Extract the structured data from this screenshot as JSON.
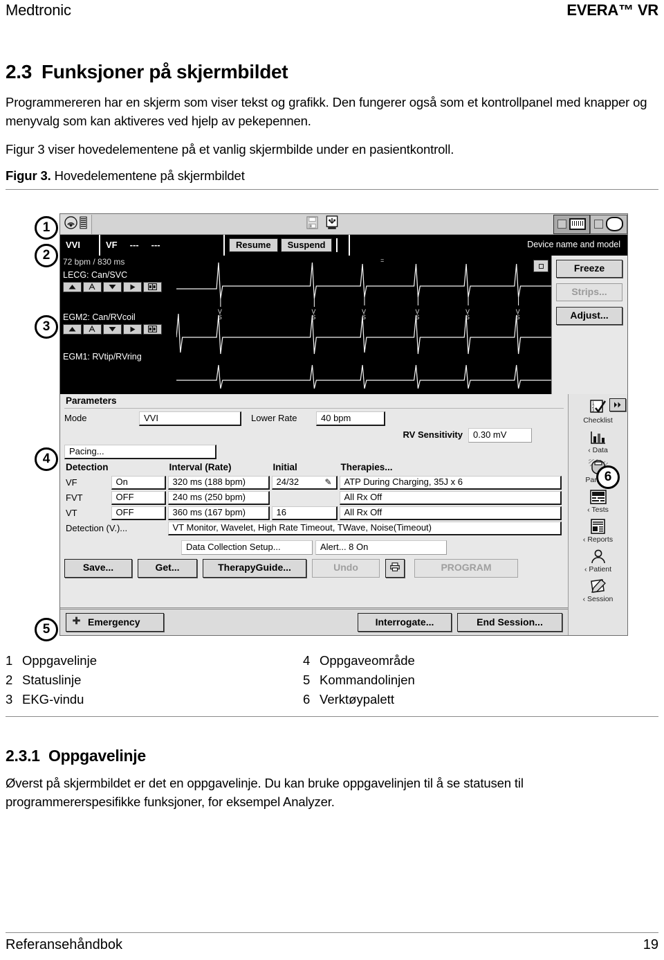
{
  "header": {
    "left": "Medtronic",
    "right": "EVERA™ VR"
  },
  "section": {
    "number": "2.3",
    "title": "Funksjoner på skjermbildet",
    "para1": "Programmereren har en skjerm som viser tekst og grafikk. Den fungerer også som et kontrollpanel med knapper og menyvalg som kan aktiveres ved hjelp av pekepennen.",
    "para2": "Figur 3 viser hovedelementene på et vanlig skjermbilde under en pasientkontroll.",
    "figure_caption_bold": "Figur 3.",
    "figure_caption_rest": "Hovedelementene på skjermbildet"
  },
  "figure": {
    "callouts": [
      "1",
      "2",
      "3",
      "4",
      "5",
      "6"
    ],
    "taskbar": {
      "icons": [
        "telemetry-icon",
        "battery-icon",
        "floppy-disk-icon",
        "usb-icon"
      ],
      "right_tabs": [
        "programmer-tab",
        "device-tab"
      ]
    },
    "statusline": {
      "mode": "VVI",
      "detection": "VF",
      "value1": "---",
      "value2": "---",
      "resume": "Resume",
      "suspend": "Suspend",
      "device_name": "Device name and model"
    },
    "ecg": {
      "rate": "72 bpm / 830 ms",
      "channel1": "LECG: Can/SVC",
      "channel2": "EGM2: Can/RVcoil",
      "channel3": "EGM1: RVtip/RVring",
      "marker": "VS",
      "buttons": [
        "Freeze",
        "Strips...",
        "Adjust..."
      ],
      "channel_controls": [
        "up-arrow-icon",
        "auto-gain-icon",
        "down-arrow-icon",
        "play-arrow-icon",
        "calipers-icon"
      ]
    },
    "parameters": {
      "heading": "Parameters",
      "mode_label": "Mode",
      "mode_value": "VVI",
      "lower_rate_label": "Lower Rate",
      "lower_rate_value": "40 bpm",
      "rv_sensitivity_label": "RV Sensitivity",
      "rv_sensitivity_value": "0.30 mV",
      "pacing_button": "Pacing..."
    },
    "detection_table": {
      "headers": [
        "Detection",
        "Interval (Rate)",
        "Initial",
        "Therapies..."
      ],
      "rows": [
        {
          "name": "VF",
          "on": "On",
          "interval": "320 ms (188 bpm)",
          "initial": "24/32",
          "pen": true,
          "therapy": "ATP During Charging, 35J x 6"
        },
        {
          "name": "FVT",
          "on": "OFF",
          "interval": "240 ms (250 bpm)",
          "initial": "",
          "pen": false,
          "therapy": "All Rx Off"
        },
        {
          "name": "VT",
          "on": "OFF",
          "interval": "360 ms (167 bpm)",
          "initial": "16",
          "pen": false,
          "therapy": "All Rx Off"
        }
      ],
      "footer_label": "Detection (V.)...",
      "footer_value": "VT Monitor, Wavelet, High Rate Timeout, TWave, Noise(Timeout)"
    },
    "task_buttons": {
      "data_collection": "Data Collection Setup...",
      "alert": "Alert... 8 On",
      "save": "Save...",
      "get": "Get...",
      "therapy_guide": "TherapyGuide...",
      "undo": "Undo",
      "print": "print-icon",
      "program": "PROGRAM"
    },
    "commandline": {
      "emergency": "Emergency",
      "emergency_icon": "emergency-cross-icon",
      "interrogate": "Interrogate...",
      "end_session": "End Session..."
    },
    "palette": {
      "next_icon": "next-arrow-icon",
      "items": [
        {
          "label": "Checklist",
          "icon": "checklist-icon"
        },
        {
          "label": "‹ Data",
          "icon": "bar-chart-icon"
        },
        {
          "label": "Params",
          "icon": "device-can-icon"
        },
        {
          "label": "‹ Tests",
          "icon": "tests-monitor-icon"
        },
        {
          "label": "‹ Reports",
          "icon": "report-page-icon"
        },
        {
          "label": "‹ Patient",
          "icon": "patient-person-icon"
        },
        {
          "label": "‹ Session",
          "icon": "session-pencil-icon"
        }
      ]
    }
  },
  "legend": {
    "left": [
      {
        "num": "1",
        "label": "Oppgavelinje"
      },
      {
        "num": "2",
        "label": "Statuslinje"
      },
      {
        "num": "3",
        "label": "EKG-vindu"
      }
    ],
    "right": [
      {
        "num": "4",
        "label": "Oppgaveområde"
      },
      {
        "num": "5",
        "label": "Kommandolinjen"
      },
      {
        "num": "6",
        "label": "Verktøypalett"
      }
    ]
  },
  "subsection": {
    "number": "2.3.1",
    "title": "Oppgavelinje",
    "para": "Øverst på skjermbildet er det en oppgavelinje. Du kan bruke oppgavelinjen til å se statusen til programmererspesifikke funksjoner, for eksempel Analyzer."
  },
  "footer": {
    "left": "Referansehåndbok",
    "right": "19"
  }
}
